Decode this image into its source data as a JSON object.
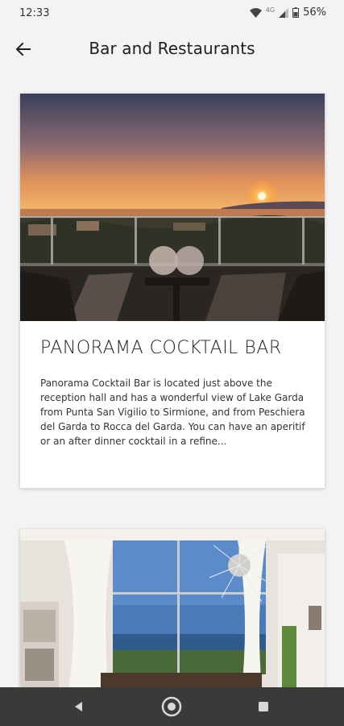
{
  "status": {
    "time": "12:33",
    "network": "4G",
    "battery": "56%"
  },
  "header": {
    "title": "Bar and Restaurants",
    "back_icon": "arrow-left-icon"
  },
  "cards": [
    {
      "title": "PANORAMA COCKTAIL BAR",
      "description": "Panorama Cocktail Bar is located just above the reception hall and has a wonderful view of Lake Garda from Punta San Vigilio to Sirmione, and from Peschiera del Garda to Rocca del Garda. You can have an aperitif or an after dinner cocktail in a refine..."
    },
    {
      "title": "",
      "description": ""
    }
  ],
  "nav": {
    "back_icon": "nav-back-triangle-icon",
    "home_icon": "nav-home-circle-icon",
    "recents_icon": "nav-recents-square-icon"
  }
}
